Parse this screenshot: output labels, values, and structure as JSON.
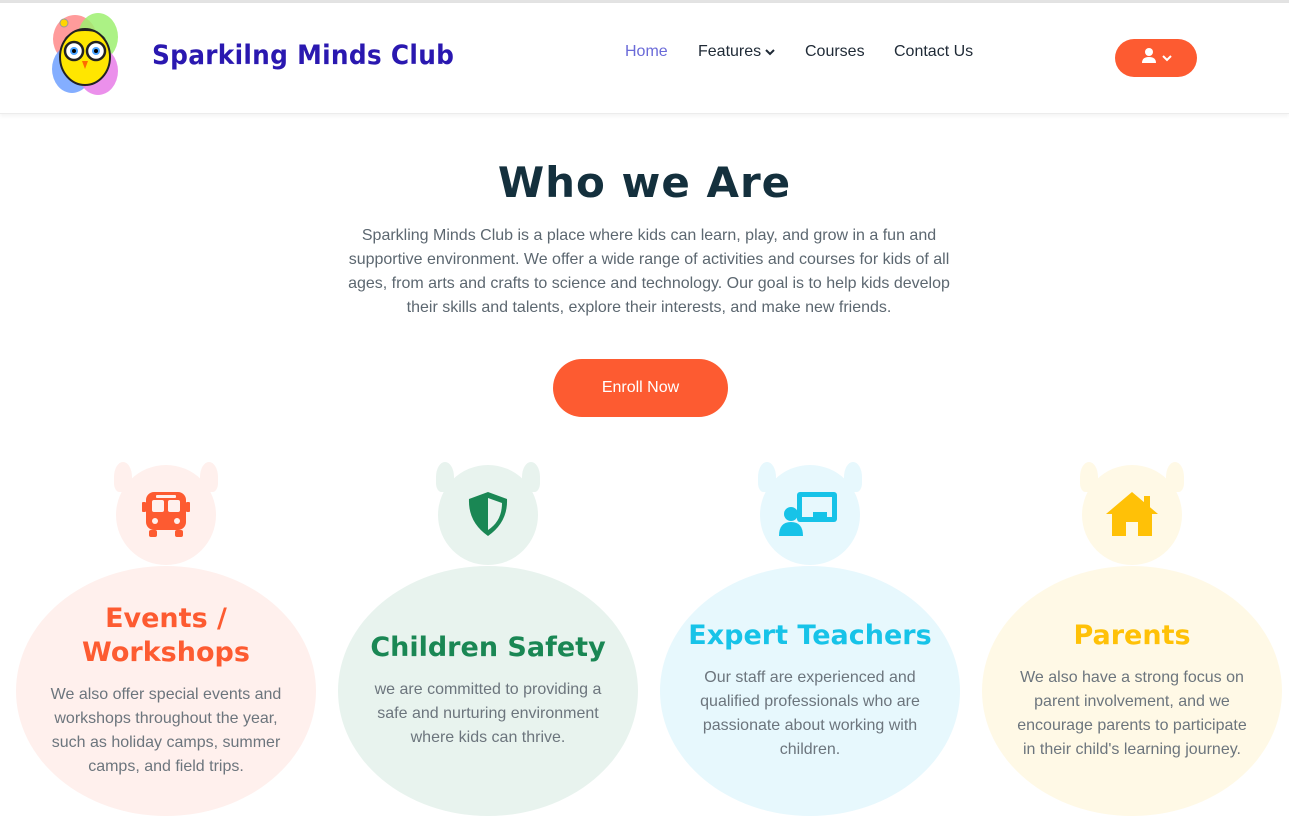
{
  "header": {
    "brand": "Sparkilng Minds Club",
    "nav": {
      "home": "Home",
      "features": "Features",
      "courses": "Courses",
      "contact": "Contact Us"
    },
    "user_menu_icon": "user-icon",
    "accent": "#fd5b31"
  },
  "hero": {
    "title": "Who we Are",
    "text": "Sparkling Minds Club is a place where kids can learn, play, and grow in a fun and supportive environment. We offer a wide range of activities and courses for kids of all ages, from arts and crafts to science and technology. Our goal is to help kids develop their skills and talents, explore their interests, and make new friends.",
    "cta": "Enroll Now"
  },
  "features": [
    {
      "title": "Events / Workshops",
      "description": "We also offer special events and workshops throughout the year, such as holiday camps, summer camps, and field trips.",
      "icon": "bus-icon",
      "color": "#fd5b31",
      "bg": "#fff0ed"
    },
    {
      "title": "Children Safety",
      "description": "we are committed to providing a safe and nurturing environment where kids can thrive.",
      "icon": "shield-icon",
      "color": "#1a8754",
      "bg": "#e8f3ee"
    },
    {
      "title": "Expert Teachers",
      "description": "Our staff are experienced and qualified professionals who are passionate about working with children.",
      "icon": "teacher-icon",
      "color": "#17c3e8",
      "bg": "#e7f8fd"
    },
    {
      "title": "Parents",
      "description": "We also have a strong focus on parent involvement, and we encourage parents to participate in their child's learning journey.",
      "icon": "home-icon",
      "color": "#ffc107",
      "bg": "#fff9e6"
    }
  ]
}
